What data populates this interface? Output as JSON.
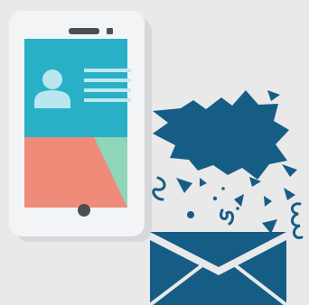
{
  "illustration": {
    "subject": "",
    "elements": {
      "phone": {
        "icon": "smartphone-icon",
        "contact_card": {
          "icon": "user-avatar-icon"
        }
      },
      "burst": {
        "icon": "speech-burst-icon"
      },
      "envelope": {
        "icon": "envelope-icon"
      }
    }
  },
  "colors": {
    "background": "#e9e9e9",
    "phone_body": "#f3f4f6",
    "phone_shadow": "#d6d8db",
    "screen_top": "#2ab0c6",
    "screen_bottom_left": "#ef8b79",
    "screen_bottom_right": "#8fd5b9",
    "avatar": "#b9e6ef",
    "text_lines": "#bfe8f0",
    "navy": "#165d86",
    "dark": "#4b4f55"
  }
}
